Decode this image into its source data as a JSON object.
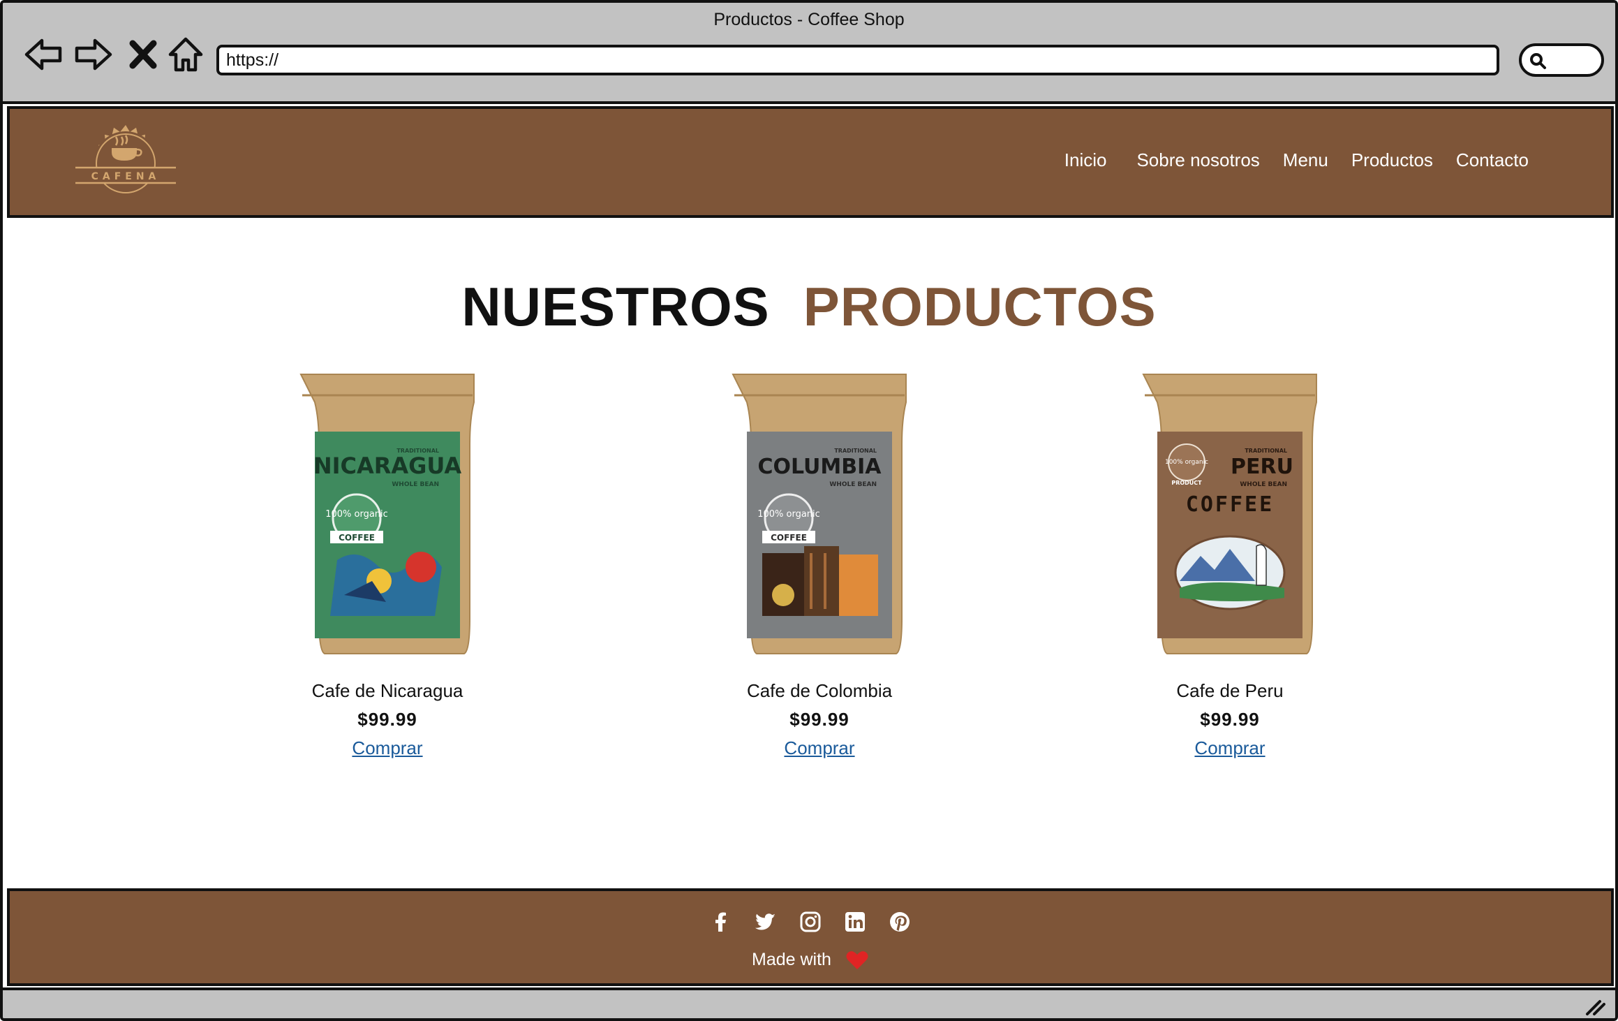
{
  "window": {
    "title": "Productos - Coffee Shop"
  },
  "address_bar": {
    "url": "https://"
  },
  "logo": {
    "text": "CAFENA"
  },
  "nav": {
    "items": [
      {
        "label": "Inicio"
      },
      {
        "label": "Sobre nosotros"
      },
      {
        "label": "Menu"
      },
      {
        "label": "Productos"
      },
      {
        "label": "Contacto"
      }
    ]
  },
  "heading": {
    "word1": "NUESTROS",
    "word2": "PRODUCTOS"
  },
  "products": [
    {
      "name": "Cafe de Nicaragua",
      "price": "$99.99",
      "cta": "Comprar",
      "bag": {
        "label": "NICARAGUA",
        "top_text": "TRADITIONAL",
        "sub_text": "WHOLE BEAN",
        "badge": "100% organic",
        "ribbon": "COFFEE",
        "color": "#3f8a5e"
      }
    },
    {
      "name": "Cafe de Colombia",
      "price": "$99.99",
      "cta": "Comprar",
      "bag": {
        "label": "COLUMBIA",
        "top_text": "TRADITIONAL",
        "sub_text": "WHOLE BEAN",
        "badge": "100% organic",
        "ribbon": "COFFEE",
        "color": "#7c7f81"
      }
    },
    {
      "name": "Cafe de Peru",
      "price": "$99.99",
      "cta": "Comprar",
      "bag": {
        "label": "PERU",
        "top_text": "TRADITIONAL",
        "sub_text": "WHOLE BEAN",
        "badge": "100% organic",
        "ribbon": "PRODUCT",
        "extra": "COFFEE",
        "color": "#8a6448"
      }
    }
  ],
  "footer": {
    "socials": [
      "facebook-icon",
      "twitter-icon",
      "instagram-icon",
      "linkedin-icon",
      "pinterest-icon"
    ],
    "made_with": "Made with"
  },
  "colors": {
    "brand_brown": "#7e5538",
    "chrome_gray": "#c2c2c2",
    "link_blue": "#1a5a9a",
    "heart_red": "#e02424"
  }
}
